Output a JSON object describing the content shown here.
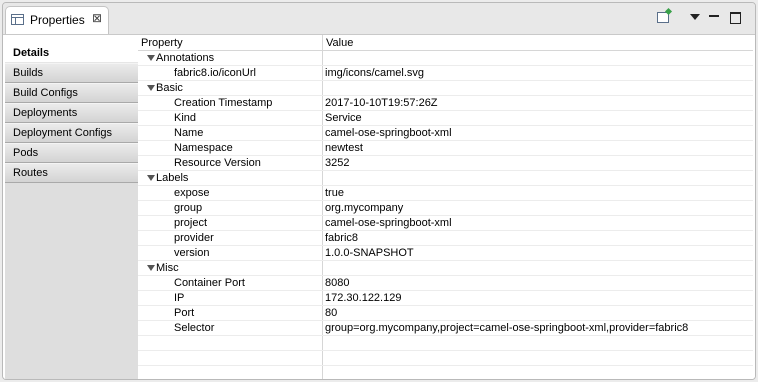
{
  "tab": {
    "title": "Properties",
    "close": "⊠"
  },
  "toolbar": {
    "new_icon": "new-view-icon",
    "menu_icon": "view-menu-icon",
    "min_icon": "minimize-icon",
    "max_icon": "maximize-icon"
  },
  "sidebar": {
    "items": [
      {
        "label": "Details",
        "active": true
      },
      {
        "label": "Builds"
      },
      {
        "label": "Build Configs"
      },
      {
        "label": "Deployments"
      },
      {
        "label": "Deployment Configs"
      },
      {
        "label": "Pods"
      },
      {
        "label": "Routes"
      }
    ]
  },
  "table": {
    "headers": {
      "property": "Property",
      "value": "Value"
    },
    "rows": [
      {
        "group": true,
        "property": "Annotations",
        "value": ""
      },
      {
        "property": "fabric8.io/iconUrl",
        "value": "img/icons/camel.svg"
      },
      {
        "group": true,
        "property": "Basic",
        "value": ""
      },
      {
        "property": "Creation Timestamp",
        "value": "2017-10-10T19:57:26Z"
      },
      {
        "property": "Kind",
        "value": "Service"
      },
      {
        "property": "Name",
        "value": "camel-ose-springboot-xml"
      },
      {
        "property": "Namespace",
        "value": "newtest"
      },
      {
        "property": "Resource Version",
        "value": "3252"
      },
      {
        "group": true,
        "property": "Labels",
        "value": ""
      },
      {
        "property": "expose",
        "value": "true"
      },
      {
        "property": "group",
        "value": "org.mycompany"
      },
      {
        "property": "project",
        "value": "camel-ose-springboot-xml"
      },
      {
        "property": "provider",
        "value": "fabric8"
      },
      {
        "property": "version",
        "value": "1.0.0-SNAPSHOT"
      },
      {
        "group": true,
        "property": "Misc",
        "value": ""
      },
      {
        "property": "Container Port",
        "value": "8080"
      },
      {
        "property": "IP",
        "value": "172.30.122.129"
      },
      {
        "property": "Port",
        "value": "80"
      },
      {
        "property": "Selector",
        "value": "group=org.mycompany,project=camel-ose-springboot-xml,provider=fabric8"
      }
    ]
  }
}
